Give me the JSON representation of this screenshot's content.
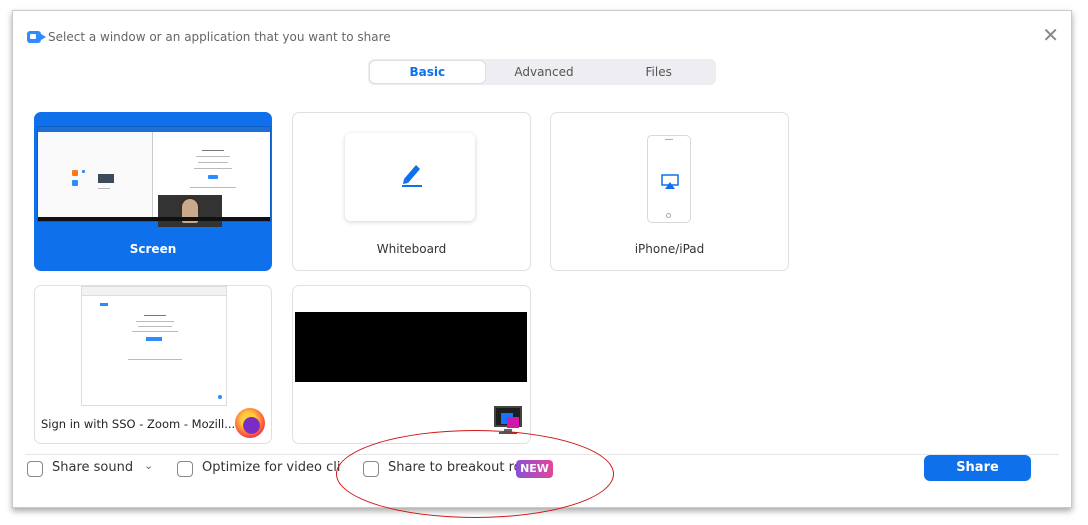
{
  "window": {
    "title": "Select a window or an application that you want to share",
    "close_glyph": "✕"
  },
  "tabs": [
    {
      "label": "Basic",
      "active": true
    },
    {
      "label": "Advanced",
      "active": false
    },
    {
      "label": "Files",
      "active": false
    }
  ],
  "tiles": {
    "screen": {
      "label": "Screen",
      "selected": true
    },
    "whiteboard": {
      "label": "Whiteboard",
      "icon": "pencil-icon"
    },
    "iphone": {
      "label": "iPhone/iPad",
      "icon": "airplay-icon"
    },
    "browser": {
      "label": "Sign in with SSO - Zoom - Mozill...",
      "icon": "firefox-icon"
    },
    "app_window": {
      "label": "",
      "icon": "monitor-app-icon"
    }
  },
  "bottom": {
    "share_sound": "Share sound",
    "share_sound_caret": "⌄",
    "optimize": "Optimize for video clip",
    "breakout": "Share to breakout rooms",
    "new_badge": "NEW",
    "share_button": "Share"
  },
  "colors": {
    "accent": "#0e71eb",
    "annotation": "#d01818"
  }
}
